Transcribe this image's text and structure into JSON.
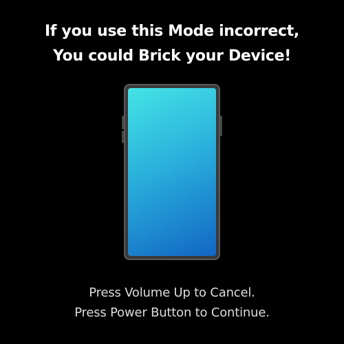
{
  "warning": {
    "line1": "If you use this Mode incorrect,",
    "line2": "You could Brick your Device!"
  },
  "device": {
    "icon": "phone-icon",
    "screen_gradient": [
      "#44e4e6",
      "#1266c4"
    ]
  },
  "instructions": {
    "line1": "Press Volume Up to Cancel.",
    "line2": "Press Power Button to Continue."
  },
  "colors": {
    "background": "#000000",
    "text": "#ffffff"
  }
}
